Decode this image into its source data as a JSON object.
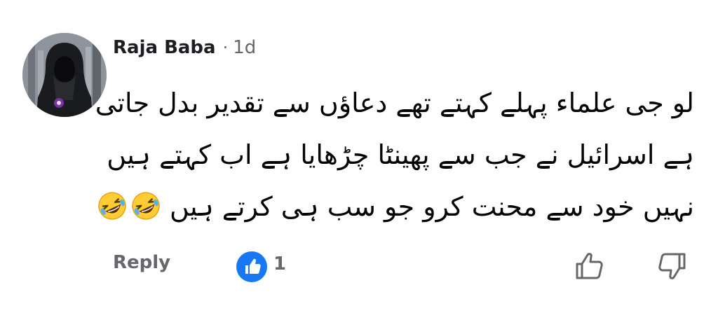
{
  "comment": {
    "author": "Raja Baba",
    "separator": "·",
    "time": "1d",
    "text_lines": [
      "لو جی علماء پہلے کہتے تھے دعاؤں سے تقدیر بدل جاتی",
      "ہے اسرائیل نے جب سے پھینٹا چڑھایا ہے اب کہتے ہیں",
      "نہیں خود سے محنت کرو جو سب ہی کرتے ہیں"
    ],
    "emoji": [
      "rolling-on-floor-laughing",
      "rolling-on-floor-laughing"
    ]
  },
  "actions": {
    "reply_label": "Reply",
    "like_count": "1",
    "icons": {
      "like_badge": "thumbs-up-icon",
      "upvote": "thumbs-up-outline-icon",
      "downvote": "thumbs-down-outline-icon"
    }
  },
  "colors": {
    "accent": "#1877f2",
    "muted_text": "#65676b",
    "primary_text": "#050505"
  }
}
